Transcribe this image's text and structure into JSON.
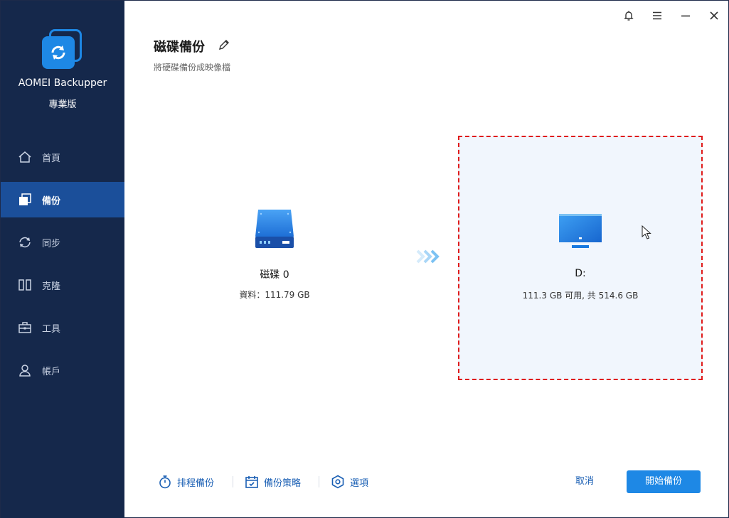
{
  "app": {
    "name": "AOMEI Backupper",
    "edition": "專業版"
  },
  "sidebar": {
    "items": [
      {
        "label": "首頁",
        "icon": "home-icon"
      },
      {
        "label": "備份",
        "icon": "backup-icon",
        "active": true
      },
      {
        "label": "同步",
        "icon": "sync-icon"
      },
      {
        "label": "克隆",
        "icon": "clone-icon"
      },
      {
        "label": "工具",
        "icon": "toolbox-icon"
      },
      {
        "label": "帳戶",
        "icon": "user-icon"
      }
    ]
  },
  "titlebar": {
    "icons": [
      "bell-icon",
      "menu-icon",
      "minimize-icon",
      "close-icon"
    ]
  },
  "page": {
    "title": "磁碟備份",
    "subtitle": "將硬碟備份成映像檔"
  },
  "source": {
    "name": "磁碟 0",
    "info": "資料：111.79 GB"
  },
  "destination": {
    "name": "D:",
    "info": "111.3 GB 可用, 共 514.6 GB"
  },
  "bottom": {
    "schedule": "排程備份",
    "strategy": "備份策略",
    "options": "選項",
    "cancel": "取消",
    "start": "開始備份"
  },
  "colors": {
    "sidebar_bg": "#15284b",
    "sidebar_active": "#1b4f9a",
    "accent": "#1e88e5",
    "link": "#1a5fb4",
    "dest_border": "#e01b1b",
    "dest_bg": "#f1f6fd"
  }
}
